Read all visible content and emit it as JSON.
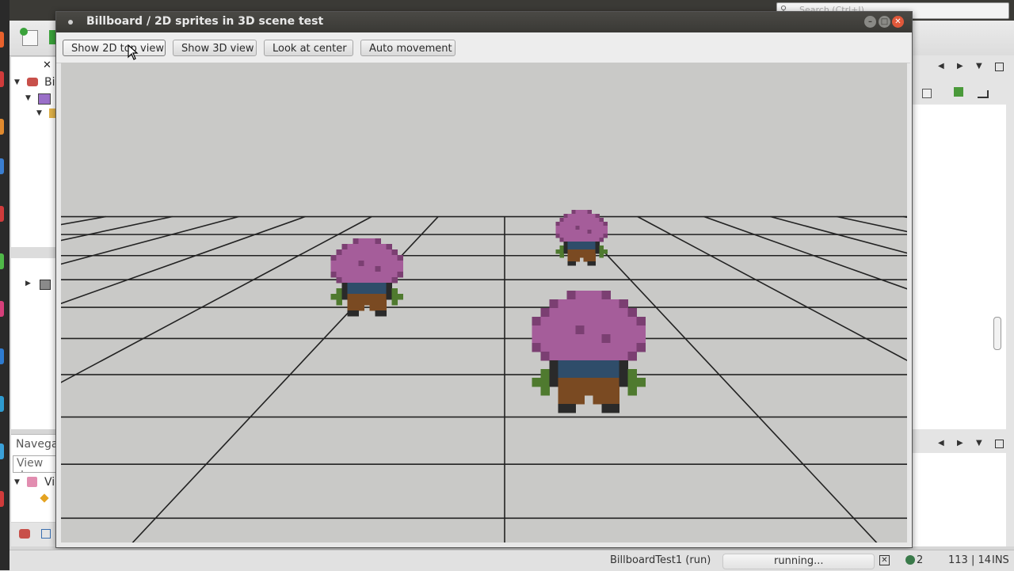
{
  "ide": {
    "search_placeholder": "Search (Ctrl+I)",
    "left_tree": [
      {
        "label": "Bi"
      },
      {
        "label": ""
      },
      {
        "label": ""
      }
    ],
    "navigator_title": "Navega",
    "navigator_filter": "View do",
    "navigator_item": "Vi"
  },
  "app": {
    "title": "Billboard / 2D sprites in 3D scene test",
    "buttons": [
      {
        "label": "Show 2D top view"
      },
      {
        "label": "Show 3D view"
      },
      {
        "label": "Look at center"
      },
      {
        "label": "Auto movement"
      }
    ]
  },
  "scene": {
    "sprites": [
      {
        "name": "character-back",
        "count": 3
      }
    ]
  },
  "status": {
    "run_label": "BillboardTest1 (run)",
    "progress_text": "running...",
    "notifications": "2",
    "position": "113 | 14",
    "mode": "INS"
  },
  "colors": {
    "hair": "#a55d9a",
    "hair_dark": "#7b3f72",
    "shirt": "#2f4d6a",
    "pants": "#7a4a22",
    "hands": "#4f7a2f",
    "grid_line": "#222222",
    "ground": "#c9c9c7"
  }
}
